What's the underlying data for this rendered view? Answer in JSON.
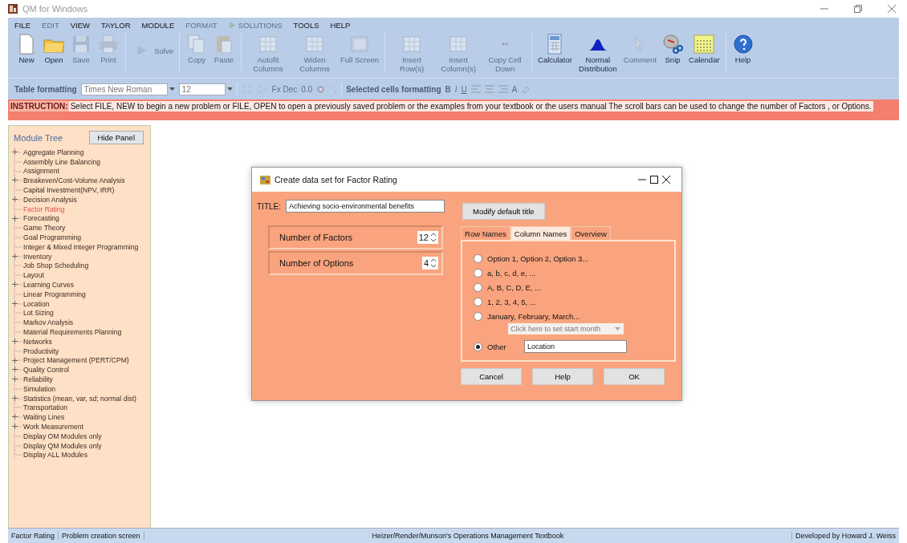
{
  "window": {
    "title": "QM for Windows"
  },
  "menu": [
    {
      "label": "FILE",
      "disabled": false
    },
    {
      "label": "EDIT",
      "disabled": true
    },
    {
      "label": "VIEW",
      "disabled": false
    },
    {
      "label": "TAYLOR",
      "disabled": false
    },
    {
      "label": "MODULE",
      "disabled": false
    },
    {
      "label": "FORMAT",
      "disabled": true
    },
    {
      "label": "SOLUTIONS",
      "disabled": true
    },
    {
      "label": "TOOLS",
      "disabled": false
    },
    {
      "label": "HELP",
      "disabled": false
    }
  ],
  "toolbar": [
    {
      "items": [
        {
          "label": "New",
          "disabled": false
        },
        {
          "label": "Open",
          "disabled": false
        },
        {
          "label": "Save",
          "disabled": true
        },
        {
          "label": "Print",
          "disabled": true
        }
      ]
    },
    {
      "items": [
        {
          "label": "Solve",
          "disabled": true
        }
      ]
    },
    {
      "items": [
        {
          "label": "Copy",
          "disabled": true
        },
        {
          "label": "Paste",
          "disabled": true
        }
      ]
    },
    {
      "items": [
        {
          "label": "Autofit Columns",
          "disabled": true
        },
        {
          "label": "Widen Columns",
          "disabled": true
        },
        {
          "label": "Full Screen",
          "disabled": true
        }
      ]
    },
    {
      "items": [
        {
          "label": "Insert Row(s)",
          "disabled": true
        },
        {
          "label": "Insert Column(s)",
          "disabled": true
        },
        {
          "label": "Copy Cell Down",
          "disabled": true
        }
      ]
    },
    {
      "items": [
        {
          "label": "Calculator",
          "disabled": false
        },
        {
          "label": "Normal Distribution",
          "disabled": false
        },
        {
          "label": "Comment",
          "disabled": true
        },
        {
          "label": "Snip",
          "disabled": false
        },
        {
          "label": "Calendar",
          "disabled": false
        }
      ]
    },
    {
      "items": [
        {
          "label": "Help",
          "disabled": false
        }
      ]
    }
  ],
  "format_bar": {
    "label": "Table formatting",
    "font": "Times New Roman",
    "size": "12",
    "decimals": "Fx Dec",
    "zero": "0.0",
    "cells_label": "Selected cells formatting",
    "bold": "B",
    "italic": "I",
    "underline": "U",
    "font_glyph": "A"
  },
  "instruction": {
    "label": "INSTRUCTION:",
    "text": "Select FILE, NEW to begin a new problem or FILE, OPEN to open a previously saved problem or the examples from your textbook or the users manual The scroll bars can be used to change the number of Factors , or Options."
  },
  "module_tree": {
    "title": "Module Tree",
    "hide_button": "Hide Panel",
    "items": [
      {
        "label": "Aggregate Planning",
        "collapsed": true,
        "selected": false
      },
      {
        "label": "Assembly Line Balancing",
        "collapsed": false,
        "selected": false
      },
      {
        "label": "Assignment",
        "collapsed": false,
        "selected": false
      },
      {
        "label": "Breakeven/Cost-Volume Analysis",
        "collapsed": true,
        "selected": false
      },
      {
        "label": "Capital Investment(NPV, IRR)",
        "collapsed": false,
        "selected": false
      },
      {
        "label": "Decision Analysis",
        "collapsed": true,
        "selected": false
      },
      {
        "label": "Factor Rating",
        "collapsed": false,
        "selected": true
      },
      {
        "label": "Forecasting",
        "collapsed": true,
        "selected": false
      },
      {
        "label": "Game Theory",
        "collapsed": false,
        "selected": false
      },
      {
        "label": "Goal Programming",
        "collapsed": false,
        "selected": false
      },
      {
        "label": "Integer & Mixed Integer Programming",
        "collapsed": false,
        "selected": false
      },
      {
        "label": "Inventory",
        "collapsed": true,
        "selected": false
      },
      {
        "label": "Job Shop Scheduling",
        "collapsed": false,
        "selected": false
      },
      {
        "label": "Layout",
        "collapsed": false,
        "selected": false
      },
      {
        "label": "Learning Curves",
        "collapsed": true,
        "selected": false
      },
      {
        "label": "Linear Programming",
        "collapsed": false,
        "selected": false
      },
      {
        "label": "Location",
        "collapsed": true,
        "selected": false
      },
      {
        "label": "Lot Sizing",
        "collapsed": false,
        "selected": false
      },
      {
        "label": "Markov Analysis",
        "collapsed": false,
        "selected": false
      },
      {
        "label": "Material Requirements Planning",
        "collapsed": false,
        "selected": false
      },
      {
        "label": "Networks",
        "collapsed": true,
        "selected": false
      },
      {
        "label": "Productivity",
        "collapsed": false,
        "selected": false
      },
      {
        "label": "Project Management (PERT/CPM)",
        "collapsed": true,
        "selected": false
      },
      {
        "label": "Quality Control",
        "collapsed": true,
        "selected": false
      },
      {
        "label": "Reliability",
        "collapsed": true,
        "selected": false
      },
      {
        "label": "Simulation",
        "collapsed": false,
        "selected": false
      },
      {
        "label": "Statistics (mean, var, sd; normal dist)",
        "collapsed": true,
        "selected": false
      },
      {
        "label": "Transportation",
        "collapsed": false,
        "selected": false
      },
      {
        "label": "Waiting Lines",
        "collapsed": true,
        "selected": false
      },
      {
        "label": "Work Measurement",
        "collapsed": true,
        "selected": false
      },
      {
        "label": "Display OM Modules only",
        "collapsed": false,
        "selected": false
      },
      {
        "label": "Display QM Modules only",
        "collapsed": false,
        "selected": false
      },
      {
        "label": "Display ALL Modules",
        "collapsed": false,
        "selected": false
      }
    ]
  },
  "dialog": {
    "title": "Create data set for Factor Rating",
    "title_label": "TITLE:",
    "title_value": "Achieving socio-environmental benefits",
    "modify_button": "Modify default title",
    "spinners": [
      {
        "label": "Number of Factors",
        "value": "12"
      },
      {
        "label": "Number of Options",
        "value": "4"
      }
    ],
    "tabs": [
      {
        "label": "Row Names",
        "selected": false
      },
      {
        "label": "Column Names",
        "selected": true
      },
      {
        "label": "Overview",
        "selected": false
      }
    ],
    "options": [
      {
        "label": "Option 1, Option 2, Option 3...",
        "selected": false
      },
      {
        "label": "a, b, c, d, e, ...",
        "selected": false
      },
      {
        "label": "A, B, C, D, E, ...",
        "selected": false
      },
      {
        "label": "1, 2, 3, 4, 5, ...",
        "selected": false
      },
      {
        "label": "January, February, March...",
        "selected": false
      }
    ],
    "month_select": {
      "placeholder": "Click here to set start month",
      "disabled": true
    },
    "other": {
      "label": "Other",
      "selected": true,
      "value": "Location"
    },
    "buttons": [
      "Cancel",
      "Help",
      "OK"
    ]
  },
  "status_bar": [
    "Factor Rating",
    "Problem creation screen",
    "Heizer/Render/Munson's Operations Management Textbook",
    "Developed by Howard J. Weiss"
  ]
}
